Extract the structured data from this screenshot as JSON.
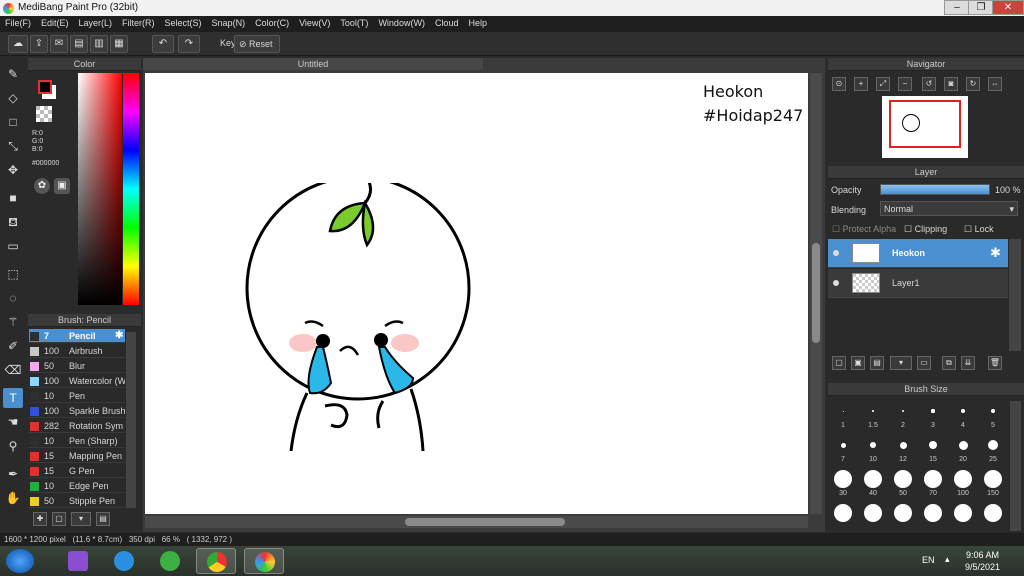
{
  "window": {
    "title": "MediBang Paint Pro (32bit)",
    "min": "–",
    "max": "❐",
    "close": "✕"
  },
  "menu": [
    "File(F)",
    "Edit(E)",
    "Layer(L)",
    "Filter(R)",
    "Select(S)",
    "Snap(N)",
    "Color(C)",
    "View(V)",
    "Tool(T)",
    "Window(W)",
    "Cloud",
    "Help"
  ],
  "toolbar": {
    "key_label": "Key",
    "reset_label": "Reset"
  },
  "color_panel": {
    "title": "Color",
    "r": "R:0",
    "g": "G:0",
    "b": "B:0",
    "hex": "#000000",
    "fg_color": "#000000",
    "bg_color": "#ffffff"
  },
  "brush_panel": {
    "title": "Brush: Pencil",
    "items": [
      {
        "size": "7",
        "name": "Pencil",
        "color": "#2f2f2f",
        "selected": true
      },
      {
        "size": "100",
        "name": "Airbrush",
        "color": "#c8c8c8"
      },
      {
        "size": "50",
        "name": "Blur",
        "color": "#f4a6ee"
      },
      {
        "size": "100",
        "name": "Watercolor (W",
        "color": "#8ad8ff"
      },
      {
        "size": "10",
        "name": "Pen",
        "color": "#2f2f2f"
      },
      {
        "size": "100",
        "name": "Sparkle Brush",
        "color": "#3050e0"
      },
      {
        "size": "282",
        "name": "Rotation Sym",
        "color": "#e03030"
      },
      {
        "size": "10",
        "name": "Pen (Sharp)",
        "color": "#2f2f2f"
      },
      {
        "size": "15",
        "name": "Mapping Pen",
        "color": "#e03030"
      },
      {
        "size": "15",
        "name": "G Pen",
        "color": "#e03030"
      },
      {
        "size": "10",
        "name": "Edge Pen",
        "color": "#20b040"
      },
      {
        "size": "50",
        "name": "Stipple Pen",
        "color": "#e8d020"
      }
    ]
  },
  "canvas": {
    "tab": "Untitled",
    "text_line1": "Heokon",
    "text_line2": "#Hoidap247"
  },
  "navigator": {
    "title": "Navigator"
  },
  "layer_panel": {
    "title": "Layer",
    "opacity_label": "Opacity",
    "opacity_value": "100 %",
    "opacity": 1.0,
    "blending_label": "Blending",
    "blending_value": "Normal",
    "protect_alpha": "Protect Alpha",
    "clipping": "Clipping",
    "lock": "Lock",
    "layers": [
      {
        "name": "Heokon",
        "selected": true
      },
      {
        "name": "Layer1",
        "selected": false
      }
    ]
  },
  "brush_size": {
    "title": "Brush Size",
    "labels": [
      "1",
      "1.5",
      "2",
      "3",
      "4",
      "5",
      "7",
      "10",
      "12",
      "15",
      "20",
      "25",
      "30",
      "40",
      "50",
      "70",
      "100",
      "150"
    ]
  },
  "status": {
    "text": "1600 * 1200 pixel   (11.6 * 8.7cm)   350 dpi   66 %   ( 1332, 972 )"
  },
  "taskbar": {
    "lang": "EN",
    "time": "9:06 AM",
    "date": "9/5/2021"
  }
}
